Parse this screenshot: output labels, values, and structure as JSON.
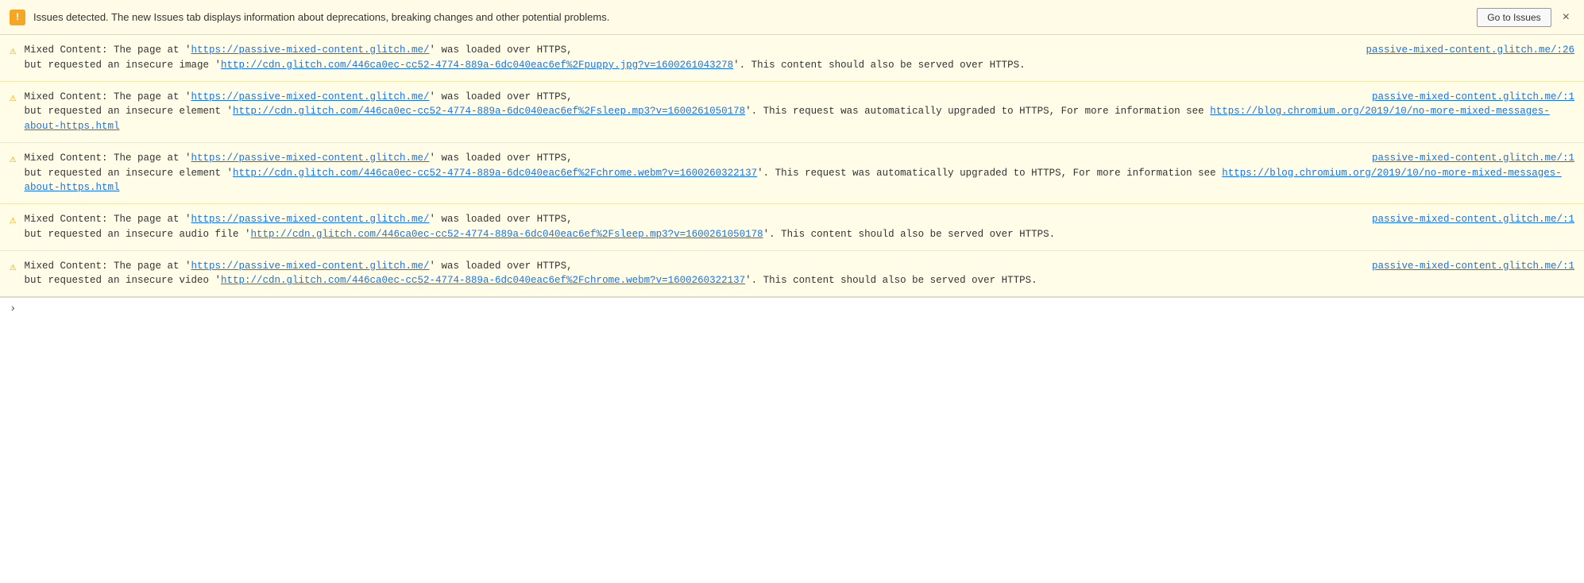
{
  "topBar": {
    "warningIcon": "!",
    "message": "Issues detected. The new Issues tab displays information about deprecations, breaking changes and other potential problems.",
    "goToIssuesLabel": "Go to Issues",
    "closeLabel": "×"
  },
  "messages": [
    {
      "id": 1,
      "sourceLink": "passive-mixed-content.glitch.me/:26",
      "sourceLinkHref": "https://passive-mixed-content.glitch.me/:26",
      "text1": "Mixed Content: The page at '",
      "pageHref": "https://passive-mixed-content.glitch.me/",
      "pageUrl": "https://passive-mixed-content.glitch.me/",
      "text2": "' was loaded over HTTPS,",
      "text3": " but requested an insecure image '",
      "resourceHref": "http://cdn.glitch.com/446ca0ec-cc52-4774-889a-6dc040eac6ef%2Fpuppy.jpg?v=1600261043278",
      "resourceUrl": "http://cdn.glitch.com/446ca0ec-cc52-4774-889a-6dc040eac6ef%2Fpuppy.jpg?v=1600261043278",
      "text4": "'. This content should also be served over HTTPS.",
      "hasBlogLink": false
    },
    {
      "id": 2,
      "sourceLink": "passive-mixed-content.glitch.me/:1",
      "sourceLinkHref": "https://passive-mixed-content.glitch.me/:1",
      "text1": "Mixed Content: The page at '",
      "pageHref": "https://passive-mixed-content.glitch.me/",
      "pageUrl": "https://passive-mixed-content.glitch.me/",
      "text2": "' was loaded over HTTPS,",
      "text3": " but requested an insecure element '",
      "resourceHref": "http://cdn.glitch.com/446ca0ec-cc52-4774-889a-6dc040eac6ef%2Fsleep.mp3?v=1600261050178",
      "resourceUrl": "http://cdn.glitch.com/446ca0ec-cc52-4774-889a-6dc040eac6ef%2Fsleep.mp3?v=1600261050178",
      "text4": "'. This request was automatically upgraded to HTTPS, For more information see ",
      "blogHref": "https://blog.chromium.org/2019/10/no-more-mixed-messages-about-https.html",
      "blogUrl": "https://blog.chromium.org/2019/10/no-more-mixed-messages-about-https.html",
      "hasBlogLink": true
    },
    {
      "id": 3,
      "sourceLink": "passive-mixed-content.glitch.me/:1",
      "sourceLinkHref": "https://passive-mixed-content.glitch.me/:1",
      "text1": "Mixed Content: The page at '",
      "pageHref": "https://passive-mixed-content.glitch.me/",
      "pageUrl": "https://passive-mixed-content.glitch.me/",
      "text2": "' was loaded over HTTPS,",
      "text3": " but requested an insecure element '",
      "resourceHref": "http://cdn.glitch.com/446ca0ec-cc52-4774-889a-6dc040eac6ef%2Fchrome.webm?v=1600260322137",
      "resourceUrl": "http://cdn.glitch.com/446ca0ec-cc52-4774-889a-6dc040eac6ef%2Fchrome.webm?v=1600260322137",
      "text4": "'. This request was automatically upgraded to HTTPS, For more information see ",
      "blogHref": "https://blog.chromium.org/2019/10/no-more-mixed-messages-about-https.html",
      "blogUrl": "https://blog.chromium.org/2019/10/no-more-mixed-messages-about-https.html",
      "hasBlogLink": true
    },
    {
      "id": 4,
      "sourceLink": "passive-mixed-content.glitch.me/:1",
      "sourceLinkHref": "https://passive-mixed-content.glitch.me/:1",
      "text1": "Mixed Content: The page at '",
      "pageHref": "https://passive-mixed-content.glitch.me/",
      "pageUrl": "https://passive-mixed-content.glitch.me/",
      "text2": "' was loaded over HTTPS,",
      "text3": " but requested an insecure audio file '",
      "resourceHref": "http://cdn.glitch.com/446ca0ec-cc52-4774-889a-6dc040eac6ef%2Fsleep.mp3?v=1600261050178",
      "resourceUrl": "http://cdn.glitch.com/446ca0ec-cc52-4774-889a-6dc040eac6ef%2Fsleep.mp3?v=1600261050178",
      "text4": "'. This content should also be served over HTTPS.",
      "hasBlogLink": false
    },
    {
      "id": 5,
      "sourceLink": "passive-mixed-content.glitch.me/:1",
      "sourceLinkHref": "https://passive-mixed-content.glitch.me/:1",
      "text1": "Mixed Content: The page at '",
      "pageHref": "https://passive-mixed-content.glitch.me/",
      "pageUrl": "https://passive-mixed-content.glitch.me/",
      "text2": "' was loaded over HTTPS,",
      "text3": " but requested an insecure video '",
      "resourceHref": "http://cdn.glitch.com/446ca0ec-cc52-4774-889a-6dc040eac6ef%2Fchrome.webm?v=1600260322137",
      "resourceUrl": "http://cdn.glitch.com/446ca0ec-cc52-4774-889a-6dc040eac6ef%2Fchrome.webm?v=1600260322137",
      "text4": "'. This content should also be served over HTTPS.",
      "hasBlogLink": false
    }
  ],
  "bottomBar": {
    "chevron": "›"
  }
}
